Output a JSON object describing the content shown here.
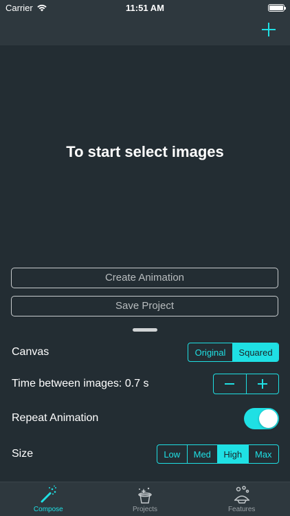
{
  "status_bar": {
    "carrier": "Carrier",
    "time": "11:51 AM"
  },
  "nav": {
    "add_icon": "plus-icon"
  },
  "preview": {
    "prompt": "To start select images"
  },
  "buttons": {
    "create_animation": "Create Animation",
    "save_project": "Save Project"
  },
  "settings": {
    "canvas": {
      "label": "Canvas",
      "options": [
        "Original",
        "Squared"
      ],
      "selected": "Squared"
    },
    "time": {
      "label": "Time between images: 0.7 s",
      "decrement": "−",
      "increment": "+"
    },
    "repeat": {
      "label": "Repeat Animation",
      "on": true
    },
    "size": {
      "label": "Size",
      "options": [
        "Low",
        "Med",
        "High",
        "Max"
      ],
      "selected": "High"
    }
  },
  "tab_bar": {
    "tabs": [
      {
        "label": "Compose",
        "icon": "magic-wand-icon",
        "active": true
      },
      {
        "label": "Projects",
        "icon": "magic-hat-icon",
        "active": false
      },
      {
        "label": "Features",
        "icon": "wizard-icon",
        "active": false
      }
    ]
  },
  "colors": {
    "accent": "#1fe0e4",
    "background": "#232d33",
    "bar": "#2e383e"
  }
}
